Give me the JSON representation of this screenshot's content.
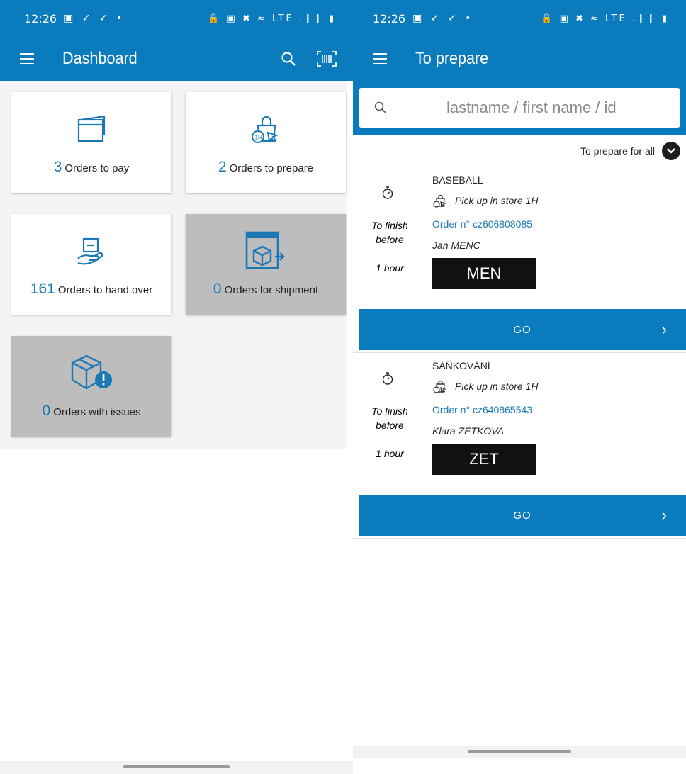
{
  "left": {
    "status": {
      "time": "12:26",
      "icons": "▣ ✓ ✓ •",
      "right_icons": "🔒 ▣ ✖ ≈ LTE .❙❙ ▮"
    },
    "appbar": {
      "title": "Dashboard"
    },
    "cards": [
      {
        "num": "3",
        "label": "Orders to pay",
        "icon": "wallet-icon"
      },
      {
        "num": "2",
        "label": "Orders to prepare",
        "icon": "store-bag-1h-icon"
      },
      {
        "num": "161",
        "label": "Orders to hand over",
        "icon": "hand-over-icon"
      },
      {
        "num": "0",
        "label": "Orders for shipment",
        "icon": "shipment-box-icon"
      },
      {
        "num": "0",
        "label": "Orders with issues",
        "icon": "box-issue-icon"
      }
    ]
  },
  "right": {
    "status": {
      "time": "12:26",
      "icons": "▣ ✓ ✓ •",
      "right_icons": "🔒 ▣ ✖ ≈ LTE .❙❙ ▮"
    },
    "appbar": {
      "title": "To prepare"
    },
    "search": {
      "placeholder": "lastname / first name / id"
    },
    "filter": {
      "label": "To prepare for all"
    },
    "orders": [
      {
        "sport": "BASEBALL",
        "pickup": "Pick up in store 1H",
        "order_no": "Order n° cz606808085",
        "customer": "Jan MENC",
        "redacted": "MEN",
        "finish_label_1": "To finish",
        "finish_label_2": "before",
        "hour": "1 hour",
        "go": "GO"
      },
      {
        "sport": "SÁŇKOVÁNÍ",
        "pickup": "Pick up in store 1H",
        "order_no": "Order n° cz640865543",
        "customer": "Klara ZETKOVA",
        "redacted": "ZET",
        "finish_label_1": "To finish",
        "finish_label_2": "before",
        "hour": "1 hour",
        "go": "GO"
      }
    ]
  },
  "colors": {
    "primary": "#0a7cbd",
    "accent_text": "#1b78b5",
    "disabled_card": "#bdbdbd"
  }
}
